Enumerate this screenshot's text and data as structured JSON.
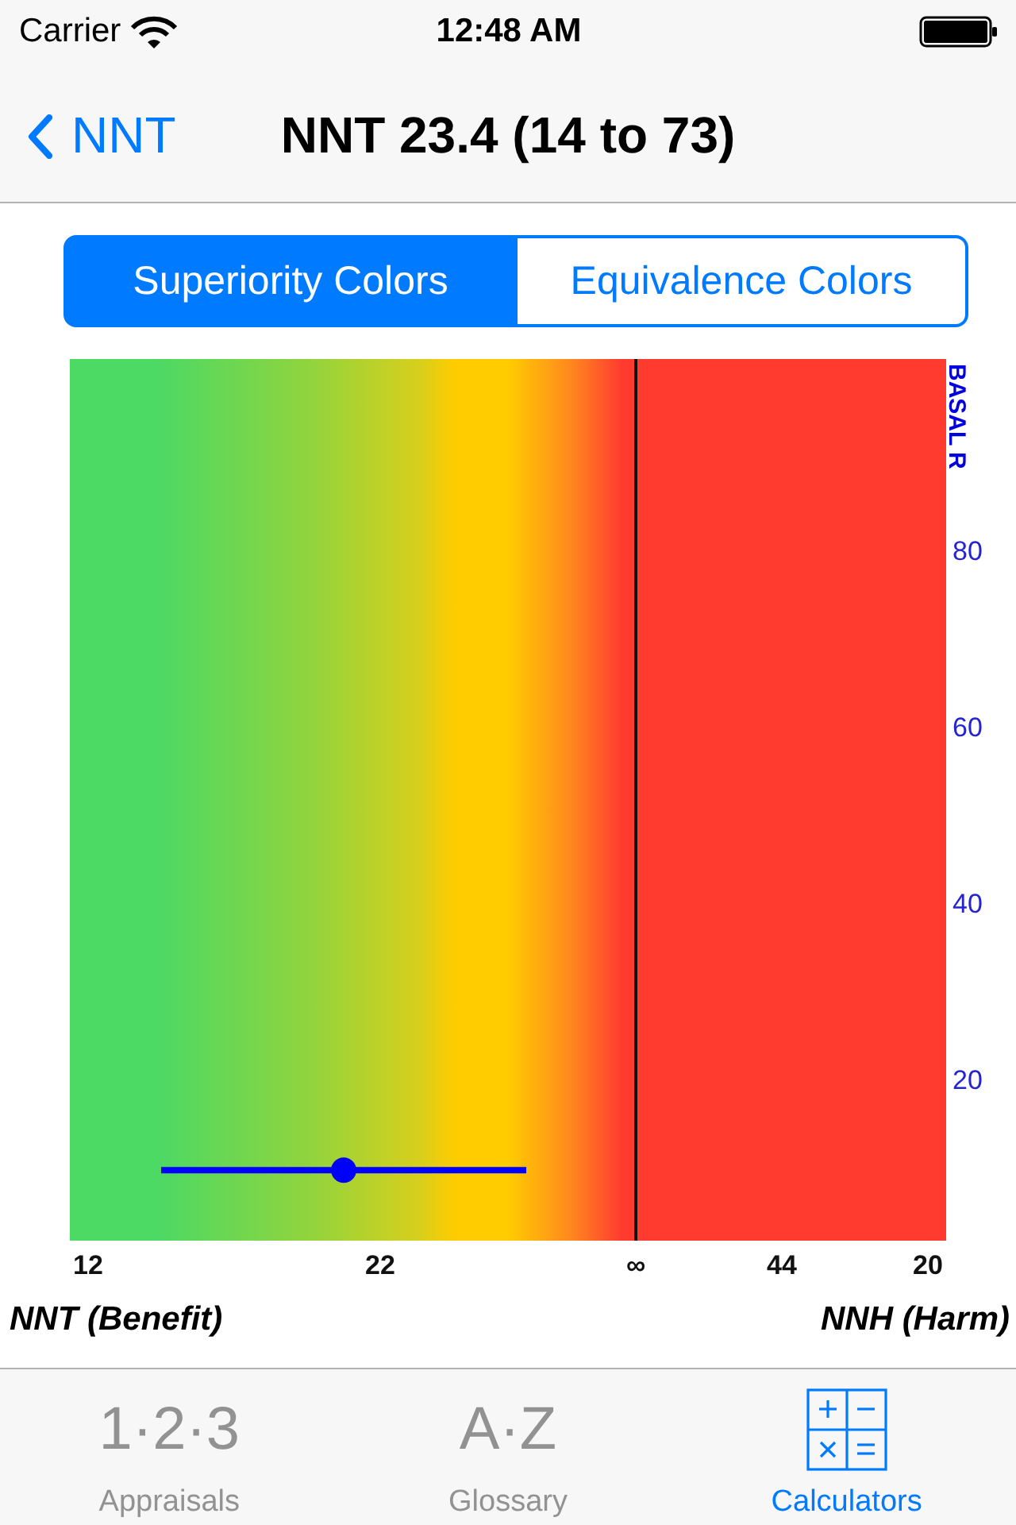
{
  "status_bar": {
    "carrier": "Carrier",
    "time": "12:48 AM"
  },
  "nav_bar": {
    "back_label": "NNT",
    "title": "NNT 23.4 (14 to 73)"
  },
  "segmented_control": [
    {
      "label": "Superiority Colors",
      "selected": true
    },
    {
      "label": "Equivalence Colors",
      "selected": false
    }
  ],
  "chart": {
    "chart_data": {
      "type": "line",
      "ylabel": "BASAL R",
      "categories": [
        "12",
        null,
        null,
        null,
        null,
        null,
        null,
        null,
        "22",
        null,
        null,
        null,
        null,
        null,
        null,
        "∞",
        null,
        null,
        null,
        "44",
        null,
        null,
        null,
        "20"
      ],
      "ylim": [
        2,
        102
      ],
      "yticks": [
        20,
        40,
        60,
        80
      ],
      "series": [
        {
          "color": "#0000ff",
          "values": [
            null,
            null,
            10,
            10,
            10,
            10,
            10,
            10,
            10,
            10,
            10,
            10,
            10,
            null,
            null,
            null,
            null,
            null,
            null,
            null,
            null,
            null,
            null,
            null
          ]
        },
        {
          "color": "#0000ff",
          "marker": "circle",
          "values": [
            null,
            null,
            null,
            null,
            null,
            null,
            null,
            10,
            null,
            null,
            null,
            null,
            null,
            null,
            null,
            null,
            null,
            null,
            null,
            null,
            null,
            null,
            null,
            null
          ]
        }
      ],
      "ref_lines": [
        {
          "axis": "x",
          "value": "∞"
        }
      ]
    },
    "benefit_label": "NNT (Benefit)",
    "harm_label": "NNH (Harm)"
  },
  "tab_bar": [
    {
      "kind": "glyph",
      "icon_text": "1·2·3",
      "label": "Appraisals",
      "selected": false
    },
    {
      "kind": "glyph",
      "icon_text": "A·Z",
      "label": "Glossary",
      "selected": false
    },
    {
      "kind": "calculator",
      "label": "Calculators",
      "selected": true
    }
  ]
}
